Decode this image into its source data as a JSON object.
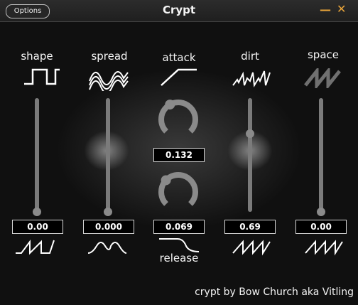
{
  "titlebar": {
    "options_label": "Options",
    "title": "Crypt",
    "minimize_glyph": "—",
    "close_glyph": "✕",
    "button_color": "#e8a43a"
  },
  "controls": {
    "shape": {
      "label": "shape",
      "value": "0.00",
      "level": 0.0,
      "top_icon": "square-wave-icon",
      "bottom_icon": "sawtooth-wave-icon"
    },
    "spread": {
      "label": "spread",
      "value": "0.000",
      "level": 0.0,
      "top_icon": "multi-sine-wave-icon",
      "bottom_icon": "sine-wave-icon"
    },
    "dirt": {
      "label": "dirt",
      "value": "0.69",
      "level": 0.69,
      "top_icon": "noisy-sawtooth-icon",
      "bottom_icon": "sawtooth-wave-icon"
    },
    "space": {
      "label": "space",
      "value": "0.00",
      "level": 0.0,
      "top_icon": "blurred-sawtooth-icon",
      "bottom_icon": "sawtooth-wave-icon"
    }
  },
  "envelope": {
    "attack_label": "attack",
    "attack_value": "0.132",
    "attack_level": 0.132,
    "attack_icon": "attack-ramp-icon",
    "release_label": "release",
    "release_value": "0.069",
    "release_level": 0.069,
    "release_icon": "release-curve-icon"
  },
  "footer": {
    "credit": "crypt by Bow Church aka Vitling"
  },
  "colors": {
    "track": "#7b7b7b",
    "knob_arc": "#8a8a8a",
    "text": "#f2f2f2",
    "accent": "#e8a43a"
  }
}
